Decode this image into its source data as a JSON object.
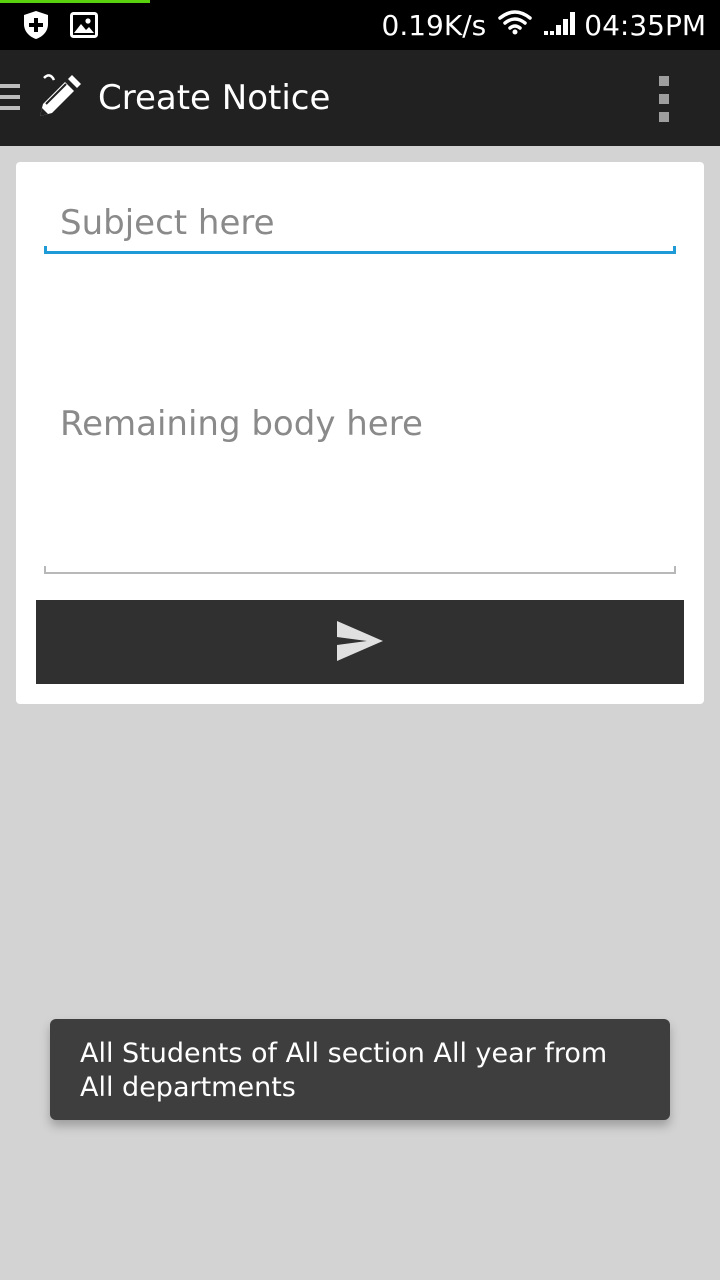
{
  "status_bar": {
    "icons_left": [
      "shield-plus-icon",
      "image-icon"
    ],
    "network_speed": "0.19K/s",
    "icons_right": [
      "wifi-icon",
      "signal-icon"
    ],
    "time": "04:35PM"
  },
  "action_bar": {
    "title": "Create Notice",
    "app_icon": "pencil-icon",
    "overflow_icon": "more-vert-icon"
  },
  "form": {
    "subject_placeholder": "Subject here",
    "subject_value": "",
    "body_placeholder": "Remaining body here",
    "body_value": "",
    "send_icon": "send-icon",
    "accent_color": "#1e9bd7"
  },
  "toast": {
    "message": "All Students of All section All year from All departments"
  }
}
